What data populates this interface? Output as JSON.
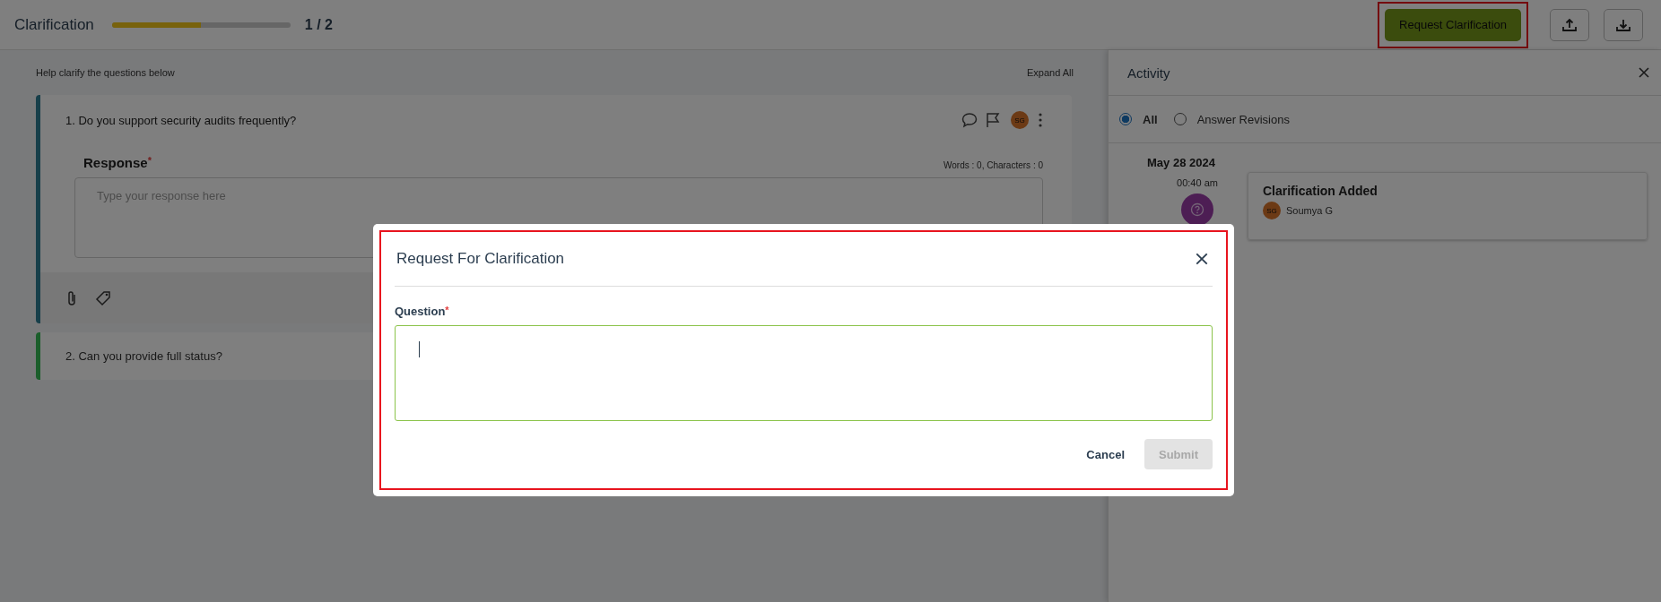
{
  "header": {
    "title": "Clarification",
    "progress": {
      "level": 0.5,
      "reading": "1 / 2"
    },
    "request_button": "Request Clarification"
  },
  "intro": "Help clarify the questions below",
  "expand_all": "Expand All",
  "questions": [
    {
      "text": "1. Do you support security audits frequently?",
      "expanded": true,
      "color": "#173f4a",
      "assignee": "SG",
      "response_label": "Response",
      "required_mark": "*",
      "counter": "Words : 0, Characters : 0",
      "placeholder": "Type your response here"
    },
    {
      "text": "2. Can you provide full status?",
      "expanded": false,
      "color": "#1b5e2b"
    }
  ],
  "activity": {
    "title": "Activity",
    "filters": [
      {
        "label": "All",
        "selected": true
      },
      {
        "label": "Answer Revisions",
        "selected": false
      }
    ],
    "groups": [
      {
        "date": "May 28 2024",
        "entries": [
          {
            "time": "00:40 am",
            "title": "Clarification Added",
            "avatar": "SG",
            "user": "Soumya G"
          }
        ]
      }
    ]
  },
  "dialog": {
    "title": "Request For Clarification",
    "field_label": "Question",
    "required_mark": "*",
    "cancel": "Cancel",
    "submit": {
      "label": "Submit",
      "disabled": true
    }
  }
}
